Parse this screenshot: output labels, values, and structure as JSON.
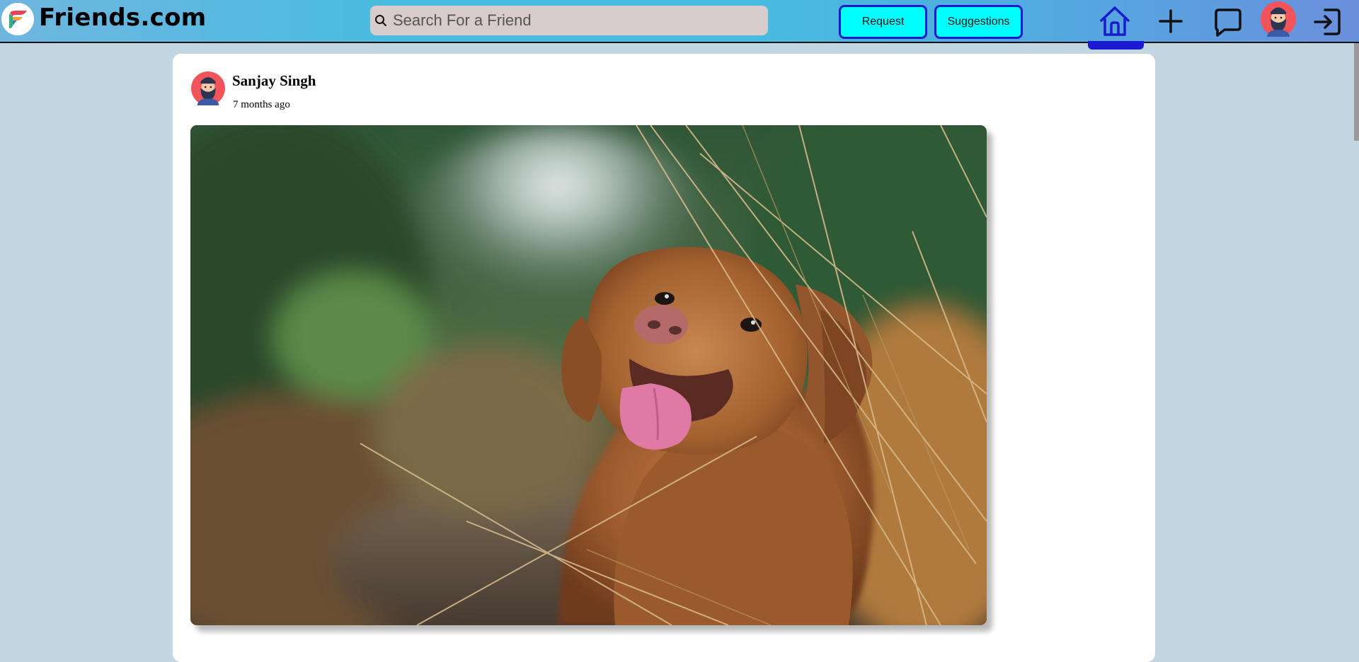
{
  "app": {
    "brand": "Friends.com"
  },
  "search": {
    "placeholder": "Search For a Friend",
    "value": ""
  },
  "nav": {
    "request_label": "Request",
    "suggestions_label": "Suggestions",
    "icons": [
      "home-icon",
      "plus-icon",
      "chat-icon",
      "avatar",
      "logout-icon"
    ],
    "active": "home"
  },
  "post": {
    "author": "Sanjay Singh",
    "time": "7 months ago",
    "image_subject": "dog-photo"
  },
  "colors": {
    "accent": "#1a1ad0",
    "button_bg": "#00ffff",
    "page_bg": "#c3d7e3",
    "avatar_bg": "#f2545b"
  }
}
